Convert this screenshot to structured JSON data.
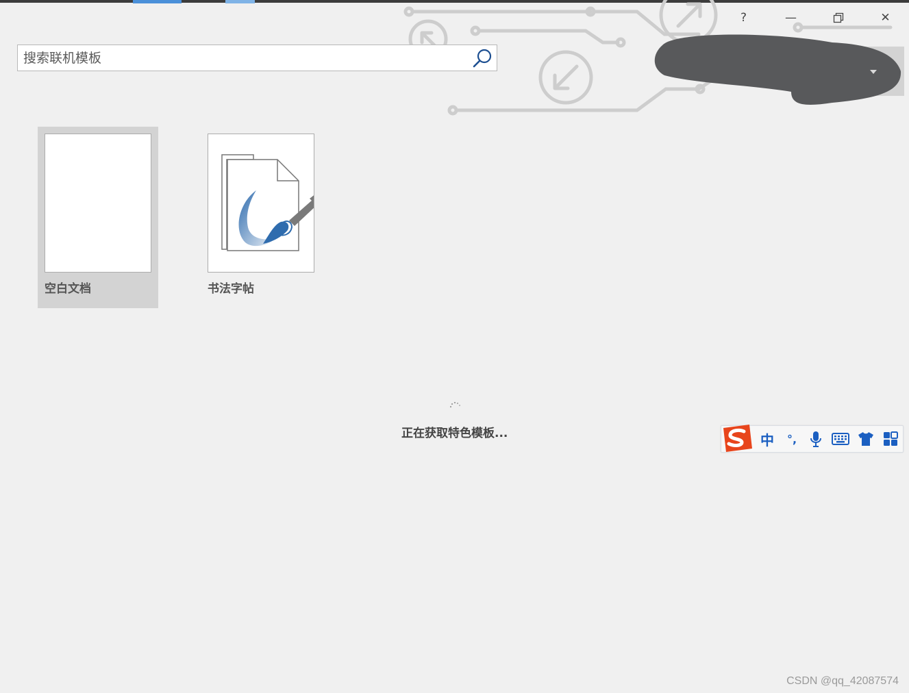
{
  "window": {
    "help_label": "?",
    "minimize_label": "—",
    "close_label": "✕"
  },
  "search": {
    "placeholder": "搜索联机模板"
  },
  "templates": [
    {
      "label": "空白文档",
      "selected": true
    },
    {
      "label": "书法字帖",
      "selected": false
    }
  ],
  "loading": {
    "text": "正在获取特色模板..."
  },
  "ime": {
    "mode_label": "中",
    "punct_label": "°,"
  },
  "watermark": "CSDN @qq_42087574",
  "colors": {
    "accent": "#4a90d9",
    "search_icon": "#1d4f91",
    "ime_blue": "#1b5fc1",
    "ime_logo": "#e8451c"
  }
}
